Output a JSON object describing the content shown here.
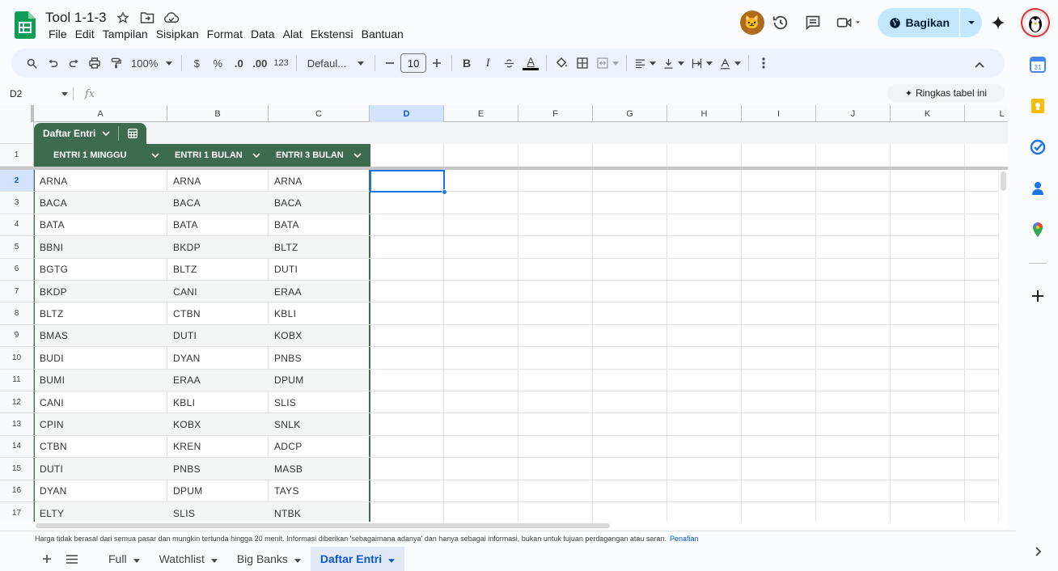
{
  "app": {
    "title": "Tool 1-1-3",
    "menu": [
      "File",
      "Edit",
      "Tampilan",
      "Sisipkan",
      "Format",
      "Data",
      "Alat",
      "Ekstensi",
      "Bantuan"
    ],
    "share_label": "Bagikan"
  },
  "toolbar": {
    "zoom": "100%",
    "currency": "$",
    "percent": "%",
    "dec_decrease": ".0",
    "dec_increase": ".00",
    "number_format": "123",
    "font": "Defaul...",
    "font_size": "10",
    "bold": "B",
    "italic": "I",
    "text_color": "A"
  },
  "formula_bar": {
    "cell_ref": "D2",
    "fx": "fx",
    "summarize_label": "Ringkas tabel ini"
  },
  "columns": [
    "A",
    "B",
    "C",
    "D",
    "E",
    "F",
    "G",
    "H",
    "I",
    "J",
    "K",
    "L"
  ],
  "selected_column": "D",
  "selected_row": "2",
  "table": {
    "name": "Daftar Entri",
    "headers": [
      "ENTRI 1 MINGGU",
      "ENTRI 1 BULAN",
      "ENTRI 3 BULAN"
    ],
    "rows": [
      {
        "n": "2",
        "a": "ARNA",
        "b": "ARNA",
        "c": "ARNA"
      },
      {
        "n": "3",
        "a": "BACA",
        "b": "BACA",
        "c": "BACA"
      },
      {
        "n": "4",
        "a": "BATA",
        "b": "BATA",
        "c": "BATA"
      },
      {
        "n": "5",
        "a": "BBNI",
        "b": "BKDP",
        "c": "BLTZ"
      },
      {
        "n": "6",
        "a": "BGTG",
        "b": "BLTZ",
        "c": "DUTI"
      },
      {
        "n": "7",
        "a": "BKDP",
        "b": "CANI",
        "c": "ERAA"
      },
      {
        "n": "8",
        "a": "BLTZ",
        "b": "CTBN",
        "c": "KBLI"
      },
      {
        "n": "9",
        "a": "BMAS",
        "b": "DUTI",
        "c": "KOBX"
      },
      {
        "n": "10",
        "a": "BUDI",
        "b": "DYAN",
        "c": "PNBS"
      },
      {
        "n": "11",
        "a": "BUMI",
        "b": "ERAA",
        "c": "DPUM"
      },
      {
        "n": "12",
        "a": "CANI",
        "b": "KBLI",
        "c": "SLIS"
      },
      {
        "n": "13",
        "a": "CPIN",
        "b": "KOBX",
        "c": "SNLK"
      },
      {
        "n": "14",
        "a": "CTBN",
        "b": "KREN",
        "c": "ADCP"
      },
      {
        "n": "15",
        "a": "DUTI",
        "b": "PNBS",
        "c": "MASB"
      },
      {
        "n": "16",
        "a": "DYAN",
        "b": "DPUM",
        "c": "TAYS"
      },
      {
        "n": "17",
        "a": "ELTY",
        "b": "SLIS",
        "c": "NTBK"
      }
    ]
  },
  "header_row_number": "1",
  "disclaimer": {
    "text": "Harga tidak berasal dari semua pasar dan mungkin tertunda hingga 20 menit. Informasi diberikan 'sebagaimana adanya' dan hanya sebagai informasi, bukan untuk tujuan perdagangan atau saran.",
    "link": "Penafian"
  },
  "sheets": [
    {
      "name": "Full",
      "active": false
    },
    {
      "name": "Watchlist",
      "active": false
    },
    {
      "name": "Big Banks",
      "active": false
    },
    {
      "name": "Daftar Entri",
      "active": true
    }
  ],
  "colors": {
    "table_header": "#3d6b4f",
    "accent": "#1a73e8",
    "share_bg": "#c2e7ff"
  }
}
